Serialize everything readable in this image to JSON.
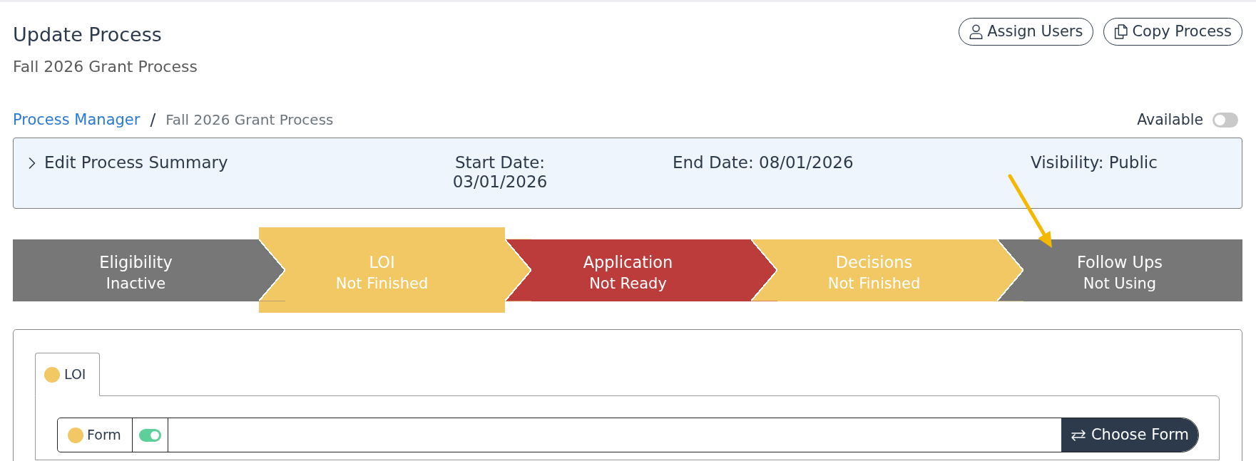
{
  "header": {
    "title": "Update Process",
    "subtitle": "Fall 2026 Grant Process",
    "actions": [
      {
        "label": "Assign Users",
        "kind": "assign"
      },
      {
        "label": "Copy Process",
        "kind": "copy"
      }
    ]
  },
  "breadcrumb": {
    "items": [
      {
        "label": "Process Manager",
        "kind": "link"
      },
      {
        "label": "Fall 2026 Grant Process",
        "kind": "current"
      }
    ],
    "separator": "/"
  },
  "availability": {
    "label": "Available",
    "on": false
  },
  "summary": {
    "toggle_label": "Edit Process Summary",
    "expanded": false,
    "start_date": "Start Date: 03/01/2026",
    "end_date": "End Date: 08/01/2026",
    "visibility": "Visibility: Public"
  },
  "steps": [
    {
      "name": "Eligibility",
      "status": "Inactive",
      "color": "#777777",
      "selected": false
    },
    {
      "name": "LOI",
      "status": "Not Finished",
      "color": "#f2c865",
      "selected": true
    },
    {
      "name": "Application",
      "status": "Not Ready",
      "color": "#bc3b3b",
      "selected": false
    },
    {
      "name": "Decisions",
      "status": "Not Finished",
      "color": "#f2c865",
      "selected": false
    },
    {
      "name": "Follow Ups",
      "status": "Not Using",
      "color": "#777777",
      "selected": false
    }
  ],
  "tabs": [
    {
      "label": "LOI",
      "color": "#f2c865",
      "selected": true
    }
  ],
  "form_row": {
    "label": "Form",
    "color": "#f2c865",
    "enabled": true,
    "button": "Choose Form"
  }
}
